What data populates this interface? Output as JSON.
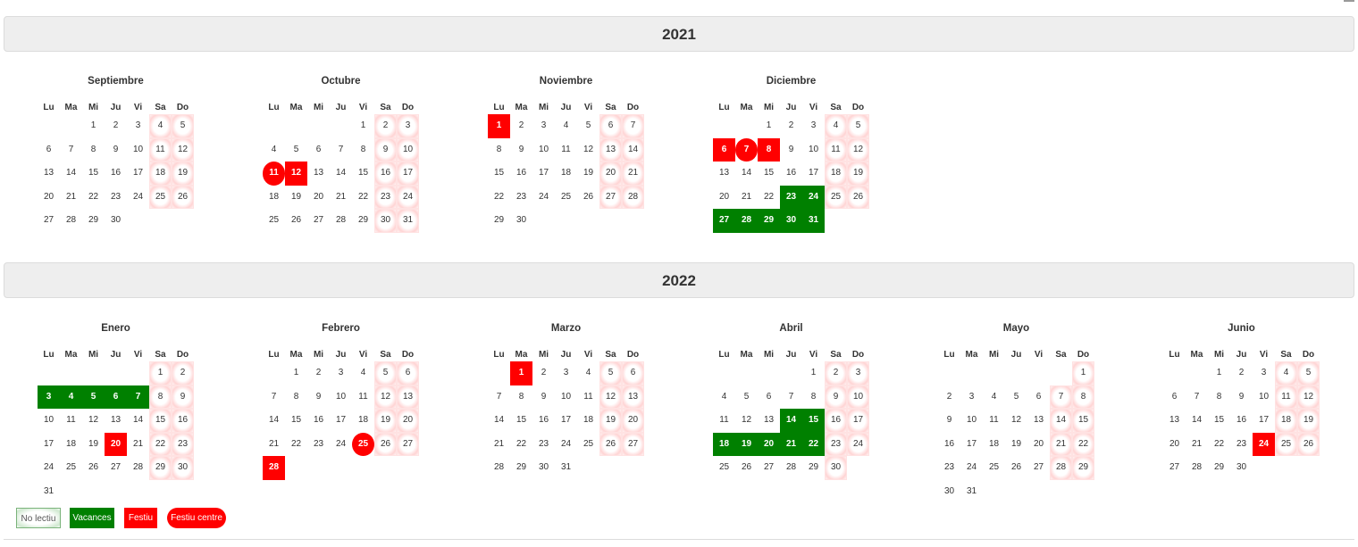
{
  "day_headers": [
    "Lu",
    "Ma",
    "Mi",
    "Ju",
    "Vi",
    "Sa",
    "Do"
  ],
  "years": [
    {
      "label": "2021",
      "months": [
        {
          "name": "Septiembre",
          "weeks": [
            [
              null,
              null,
              1,
              2,
              3,
              4,
              5
            ],
            [
              6,
              7,
              8,
              9,
              10,
              11,
              12
            ],
            [
              13,
              14,
              15,
              16,
              17,
              18,
              19
            ],
            [
              20,
              21,
              22,
              23,
              24,
              25,
              26
            ],
            [
              27,
              28,
              29,
              30,
              null,
              null,
              null
            ]
          ],
          "vacances": [],
          "festiu": [],
          "festiu_centre": []
        },
        {
          "name": "Octubre",
          "weeks": [
            [
              null,
              null,
              null,
              null,
              1,
              2,
              3
            ],
            [
              4,
              5,
              6,
              7,
              8,
              9,
              10
            ],
            [
              11,
              12,
              13,
              14,
              15,
              16,
              17
            ],
            [
              18,
              19,
              20,
              21,
              22,
              23,
              24
            ],
            [
              25,
              26,
              27,
              28,
              29,
              30,
              31
            ]
          ],
          "vacances": [],
          "festiu": [
            12
          ],
          "festiu_centre": [
            11
          ]
        },
        {
          "name": "Noviembre",
          "weeks": [
            [
              1,
              2,
              3,
              4,
              5,
              6,
              7
            ],
            [
              8,
              9,
              10,
              11,
              12,
              13,
              14
            ],
            [
              15,
              16,
              17,
              18,
              19,
              20,
              21
            ],
            [
              22,
              23,
              24,
              25,
              26,
              27,
              28
            ],
            [
              29,
              30,
              null,
              null,
              null,
              null,
              null
            ]
          ],
          "vacances": [],
          "festiu": [
            1
          ],
          "festiu_centre": []
        },
        {
          "name": "Diciembre",
          "weeks": [
            [
              null,
              null,
              1,
              2,
              3,
              4,
              5
            ],
            [
              6,
              7,
              8,
              9,
              10,
              11,
              12
            ],
            [
              13,
              14,
              15,
              16,
              17,
              18,
              19
            ],
            [
              20,
              21,
              22,
              23,
              24,
              25,
              26
            ],
            [
              27,
              28,
              29,
              30,
              31,
              null,
              null
            ]
          ],
          "vacances": [
            23,
            24,
            27,
            28,
            29,
            30,
            31
          ],
          "festiu": [
            6,
            8
          ],
          "festiu_centre": [
            7
          ]
        }
      ]
    },
    {
      "label": "2022",
      "months": [
        {
          "name": "Enero",
          "weeks": [
            [
              null,
              null,
              null,
              null,
              null,
              1,
              2
            ],
            [
              3,
              4,
              5,
              6,
              7,
              8,
              9
            ],
            [
              10,
              11,
              12,
              13,
              14,
              15,
              16
            ],
            [
              17,
              18,
              19,
              20,
              21,
              22,
              23
            ],
            [
              24,
              25,
              26,
              27,
              28,
              29,
              30
            ],
            [
              31,
              null,
              null,
              null,
              null,
              null,
              null
            ]
          ],
          "vacances": [
            3,
            4,
            5,
            6,
            7
          ],
          "festiu": [
            20
          ],
          "festiu_centre": []
        },
        {
          "name": "Febrero",
          "weeks": [
            [
              null,
              1,
              2,
              3,
              4,
              5,
              6
            ],
            [
              7,
              8,
              9,
              10,
              11,
              12,
              13
            ],
            [
              14,
              15,
              16,
              17,
              18,
              19,
              20
            ],
            [
              21,
              22,
              23,
              24,
              25,
              26,
              27
            ],
            [
              28,
              null,
              null,
              null,
              null,
              null,
              null
            ]
          ],
          "vacances": [],
          "festiu": [
            28
          ],
          "festiu_centre": [
            25
          ]
        },
        {
          "name": "Marzo",
          "weeks": [
            [
              null,
              1,
              2,
              3,
              4,
              5,
              6
            ],
            [
              7,
              8,
              9,
              10,
              11,
              12,
              13
            ],
            [
              14,
              15,
              16,
              17,
              18,
              19,
              20
            ],
            [
              21,
              22,
              23,
              24,
              25,
              26,
              27
            ],
            [
              28,
              29,
              30,
              31,
              null,
              null,
              null
            ]
          ],
          "vacances": [],
          "festiu": [
            1
          ],
          "festiu_centre": []
        },
        {
          "name": "Abril",
          "weeks": [
            [
              null,
              null,
              null,
              null,
              1,
              2,
              3
            ],
            [
              4,
              5,
              6,
              7,
              8,
              9,
              10
            ],
            [
              11,
              12,
              13,
              14,
              15,
              16,
              17
            ],
            [
              18,
              19,
              20,
              21,
              22,
              23,
              24
            ],
            [
              25,
              26,
              27,
              28,
              29,
              30,
              null
            ]
          ],
          "vacances": [
            14,
            15,
            18,
            19,
            20,
            21,
            22
          ],
          "festiu": [],
          "festiu_centre": []
        },
        {
          "name": "Mayo",
          "weeks": [
            [
              null,
              null,
              null,
              null,
              null,
              null,
              1
            ],
            [
              2,
              3,
              4,
              5,
              6,
              7,
              8
            ],
            [
              9,
              10,
              11,
              12,
              13,
              14,
              15
            ],
            [
              16,
              17,
              18,
              19,
              20,
              21,
              22
            ],
            [
              23,
              24,
              25,
              26,
              27,
              28,
              29
            ],
            [
              30,
              31,
              null,
              null,
              null,
              null,
              null
            ]
          ],
          "vacances": [],
          "festiu": [],
          "festiu_centre": []
        },
        {
          "name": "Junio",
          "weeks": [
            [
              null,
              null,
              1,
              2,
              3,
              4,
              5
            ],
            [
              6,
              7,
              8,
              9,
              10,
              11,
              12
            ],
            [
              13,
              14,
              15,
              16,
              17,
              18,
              19
            ],
            [
              20,
              21,
              22,
              23,
              24,
              25,
              26
            ],
            [
              27,
              28,
              29,
              30,
              null,
              null,
              null
            ]
          ],
          "vacances": [],
          "festiu": [
            24
          ],
          "festiu_centre": []
        }
      ]
    }
  ],
  "legend": {
    "no_lectiu": "No lectiu",
    "vacances": "Vacances",
    "festiu": "Festiu",
    "festiu_centre": "Festiu centre"
  },
  "colors": {
    "vacances": "#008000",
    "festiu": "#ff0000",
    "no_lectiu_tint": "#ffd4d4"
  }
}
